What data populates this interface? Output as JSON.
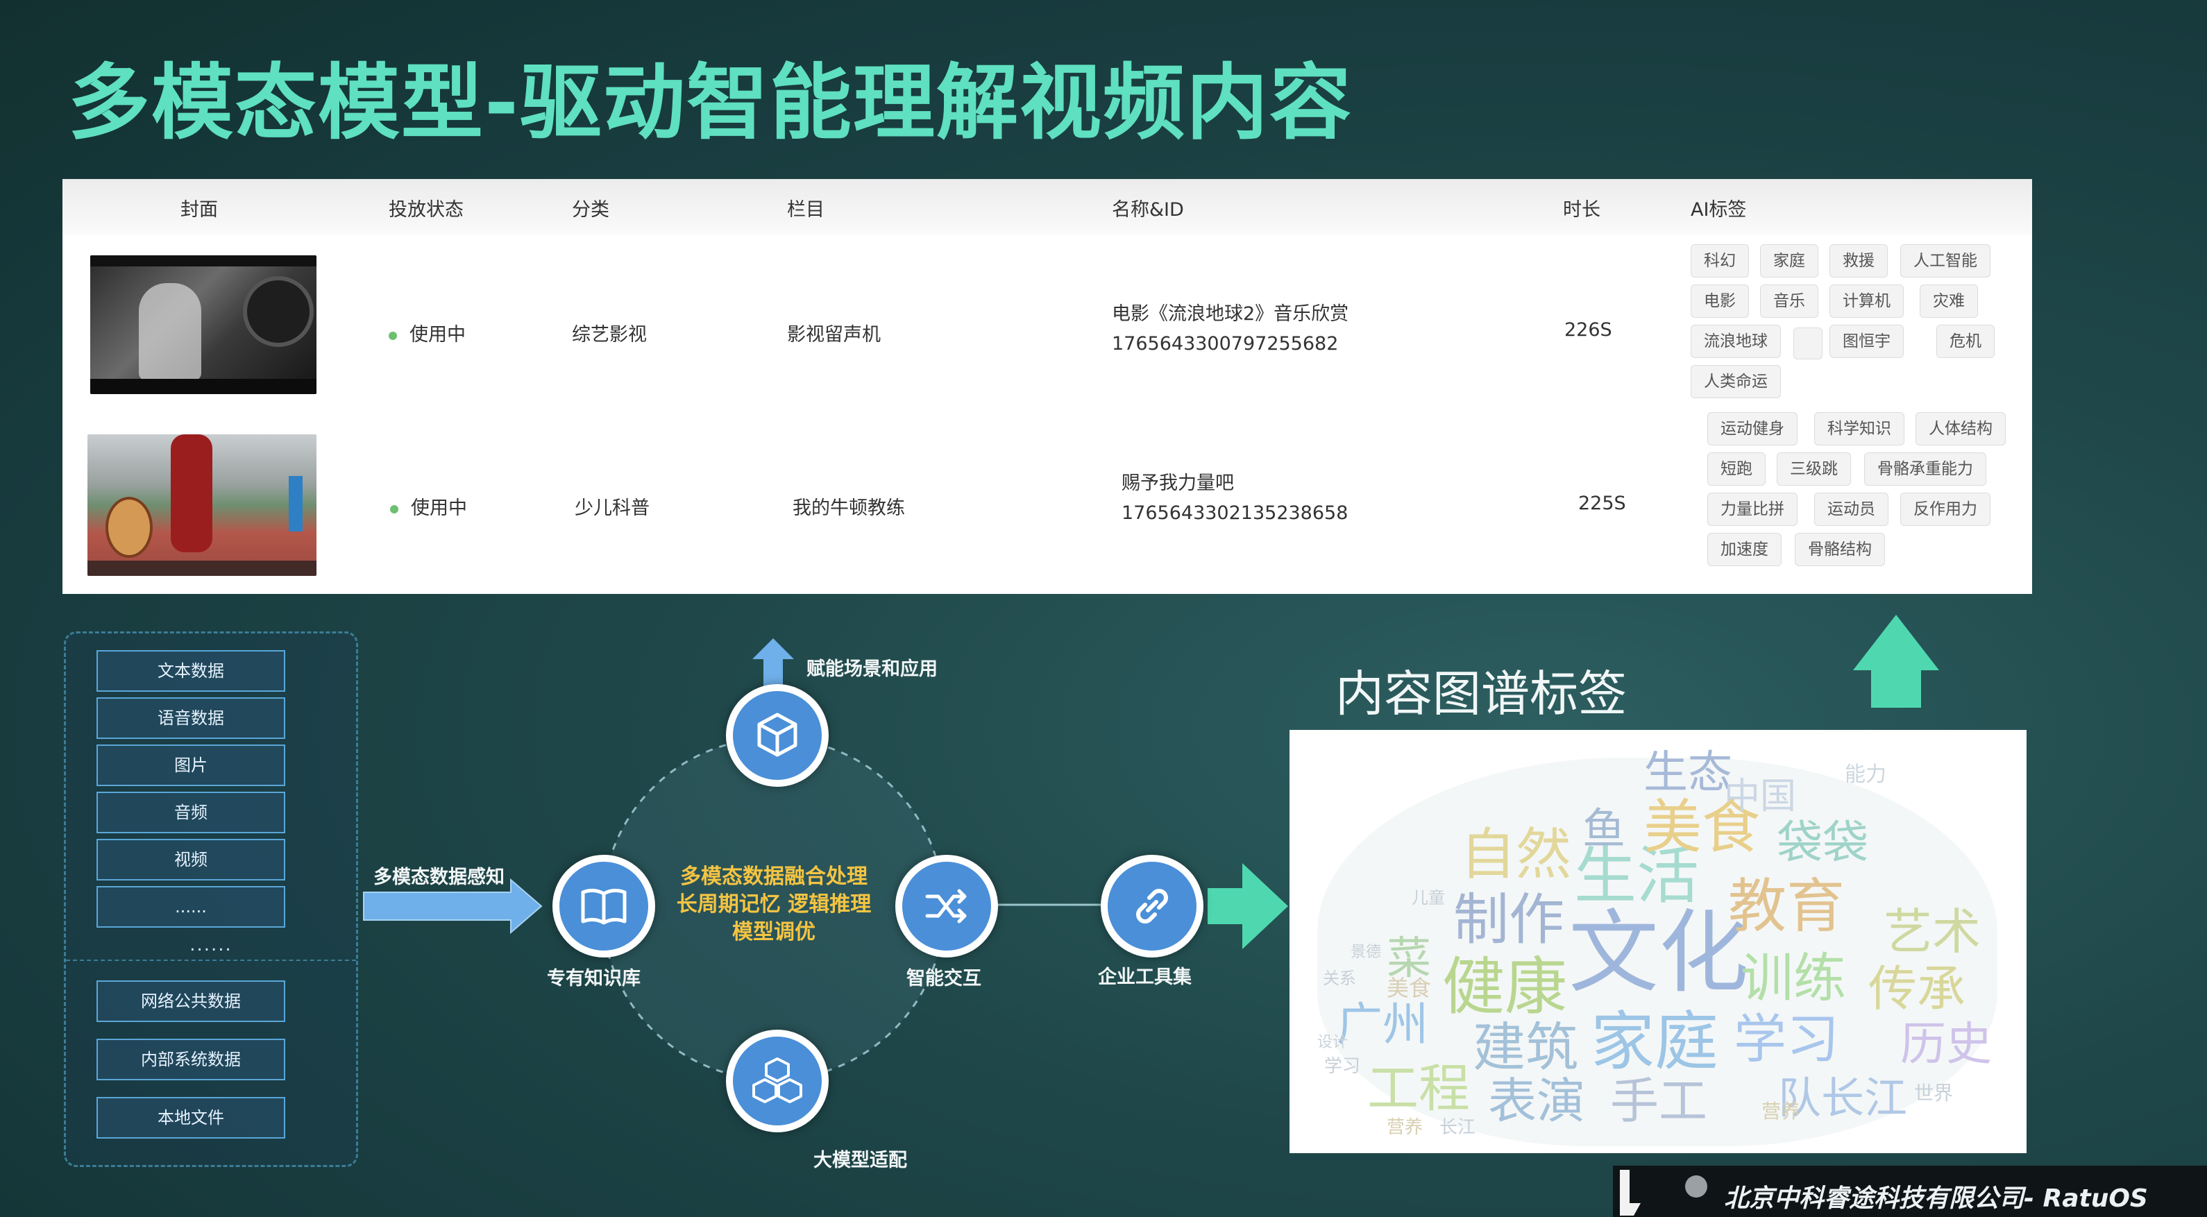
{
  "title": "多模态模型-驱动智能理解视频内容",
  "table": {
    "headers": [
      "封面",
      "投放状态",
      "分类",
      "栏目",
      "名称&ID",
      "时长",
      "AI标签"
    ],
    "rows": [
      {
        "status": "使用中",
        "category": "综艺影视",
        "column": "影视留声机",
        "name": "电影《流浪地球2》音乐欣赏",
        "id": "1765643300797255682",
        "duration": "226S",
        "tags": [
          "科幻",
          "家庭",
          "救援",
          "人工智能",
          "电影",
          "音乐",
          "计算机",
          "灾难",
          "流浪地球",
          "",
          "图恒宇",
          "危机",
          "人类命运"
        ]
      },
      {
        "status": "使用中",
        "category": "少儿科普",
        "column": "我的牛顿教练",
        "name": "赐予我力量吧",
        "id": "1765643302135238658",
        "duration": "225S",
        "tags": [
          "运动健身",
          "科学知识",
          "人体结构",
          "短跑",
          "三级跳",
          "骨骼承重能力",
          "力量比拼",
          "运动员",
          "反作用力",
          "加速度",
          "骨骼结构"
        ]
      }
    ]
  },
  "sources": {
    "group1": [
      "文本数据",
      "语音数据",
      "图片",
      "音频",
      "视频",
      "......"
    ],
    "ellipsis": "......",
    "group2": [
      "网络公共数据",
      "内部系统数据",
      "本地文件"
    ]
  },
  "diagram": {
    "input_label": "多模态数据感知",
    "top_label": "赋能场景和应用",
    "left_node": "专有知识库",
    "right_node": "智能交互",
    "bottom_node": "大模型适配",
    "tools_node": "企业工具集",
    "center_lines": [
      "多模态数据融合处理",
      "长周期记忆 逻辑推理",
      "模型调优"
    ]
  },
  "kg": {
    "title": "内容图谱标签",
    "words": [
      "文化",
      "生活",
      "健康",
      "家庭",
      "教育",
      "美食",
      "学习",
      "建筑",
      "训练",
      "制作",
      "自然",
      "传承",
      "艺术",
      "工程",
      "表演",
      "手工",
      "历史",
      "袋袋",
      "广州",
      "生态",
      "鱼",
      "菜",
      "中国",
      "队长江",
      "能力",
      "设计",
      "美食",
      "学习",
      "营养",
      "世界",
      "长江",
      "关系",
      "儿童",
      "景德",
      "营养"
    ]
  },
  "footer": "北京中科睿途科技有限公司- RatuOS",
  "colors": {
    "title": "#5fe0c0",
    "accent_arrow": "#4fd8b0",
    "node_blue": "#4a8fd8",
    "center_text": "#f4c443"
  }
}
